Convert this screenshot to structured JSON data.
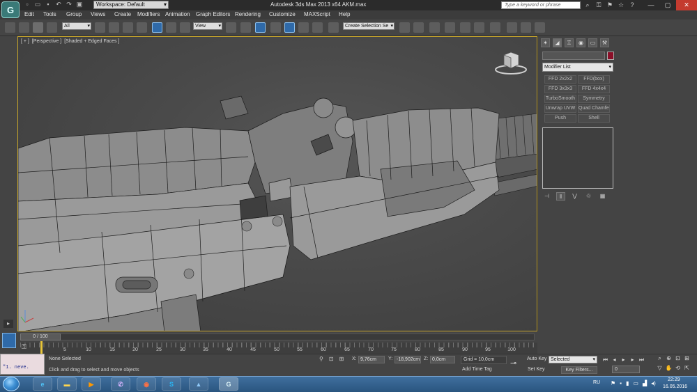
{
  "titlebar": {
    "title": "Autodesk 3ds Max 2013 x64     AKM.max",
    "workspace": "Workspace: Default",
    "search_placeholder": "Type a keyword or phrase"
  },
  "menu": [
    "Edit",
    "Tools",
    "Group",
    "Views",
    "Create",
    "Modifiers",
    "Animation",
    "Graph Editors",
    "Rendering",
    "Customize",
    "MAXScript",
    "Help"
  ],
  "toolbar": {
    "filter": "All",
    "ref_coord": "View",
    "named_selection": "Create Selection Se"
  },
  "viewport": {
    "label_plus": "[ + ]",
    "label_view": "[Perspective ]",
    "label_shading": "[Shaded + Edged Faces ]"
  },
  "command_panel": {
    "modifier_list": "Modifier List",
    "modifiers": [
      "FFD 2x2x2",
      "FFD(box)",
      "FFD 3x3x3",
      "FFD 4x4x4",
      "TurboSmooth",
      "Symmetry",
      "Unwrap UVW",
      "Quad Chamfer",
      "Push",
      "Shell"
    ]
  },
  "timeline": {
    "frame_display": "0 / 100",
    "ticks": [
      "5",
      "10",
      "15",
      "20",
      "25",
      "30",
      "35",
      "40",
      "45",
      "50",
      "55",
      "60",
      "65",
      "70",
      "75",
      "80",
      "85",
      "90",
      "95",
      "100"
    ]
  },
  "status": {
    "listener_text": "\"1.    neve.",
    "selection": "None Selected",
    "prompt": "Click and drag to select and move objects",
    "x_label": "X:",
    "x": "9,76cm",
    "y_label": "Y:",
    "y": "-18,902cm",
    "z_label": "Z:",
    "z": "0,0cm",
    "grid": "Grid = 10,0cm",
    "add_time_tag": "Add Time Tag",
    "auto_key": "Auto Key",
    "set_key": "Set Key",
    "selected": "Selected",
    "key_filters": "Key Filters...",
    "frame": "0"
  },
  "taskbar": {
    "language": "RU",
    "time": "22:29",
    "date": "16.05.2016"
  },
  "colors": {
    "viewport_border": "#c8a62c",
    "object_color_swatch": "#8a0f28",
    "active_tool": "#2f6aa9"
  }
}
